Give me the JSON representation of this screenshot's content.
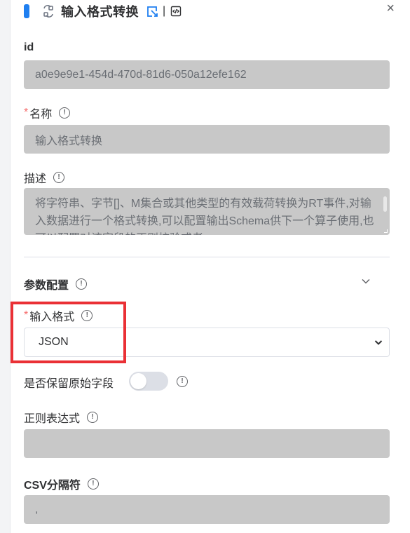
{
  "header": {
    "title": "输入格式转换",
    "separator": "|",
    "close_glyph": "×",
    "icons": [
      "node-flow-icon",
      "edit-icon",
      "code-icon",
      "close-icon"
    ]
  },
  "fields": {
    "id": {
      "label": "id",
      "value": "a0e9e9e1-454d-470d-81d6-050a12efe162"
    },
    "name": {
      "required_mark": "*",
      "label": "名称",
      "value": "输入格式转换"
    },
    "description": {
      "label": "描述",
      "value": "将字符串、字节[]、M集合或其他类型的有效载荷转换为RT事件,对输入数据进行一个格式转换,可以配置输出Schema供下一个算子使用,也可以配置对该字段的正则校验或者..."
    }
  },
  "params": {
    "section_title": "参数配置",
    "input_format": {
      "required_mark": "*",
      "label": "输入格式",
      "value": "JSON"
    },
    "keep_raw": {
      "label": "是否保留原始字段",
      "enabled": false
    },
    "regex": {
      "label": "正则表达式",
      "value": ""
    },
    "csv_sep": {
      "label": "CSV分隔符",
      "placeholder": ","
    }
  },
  "info_glyph": "!",
  "colors": {
    "accent": "#1f7ff0",
    "required": "#f56c6c",
    "highlight": "#ea3035",
    "field_bg": "#c8c8c8"
  }
}
